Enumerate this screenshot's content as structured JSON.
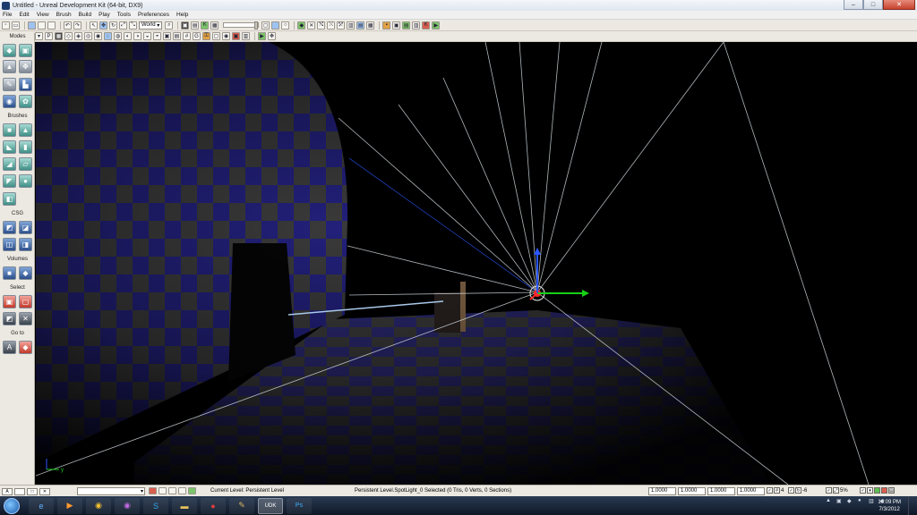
{
  "window": {
    "title": "Untitled - Unreal Development Kit (64-bit, DX9)",
    "minimize": "–",
    "maximize": "□",
    "close": "✕"
  },
  "menu": [
    "File",
    "Edit",
    "View",
    "Brush",
    "Build",
    "Play",
    "Tools",
    "Preferences",
    "Help"
  ],
  "toolbar": {
    "coord_system": "World"
  },
  "modes_panel": {
    "header": "Modes",
    "brushes_label": "Brushes",
    "csg_label": "CSG",
    "volumes_label": "Volumes",
    "select_label": "Select",
    "goto_label": "Go to"
  },
  "viewport": {
    "axis_label": "y"
  },
  "statusbar": {
    "current_level": "Current Level:  Persistent Level",
    "selection_status": "Persistent Level.SpotLight_0 Selected (0 Tris, 0 Verts, 0 Sections)",
    "drag_grid": [
      "1.0000",
      "1.0000",
      "1.0000",
      "1.0000"
    ],
    "grid_size": "4",
    "rotation_snap": "-6",
    "scale_snap": "5%"
  },
  "taskbar": {
    "time": "10:09 PM",
    "date": "7/3/2012"
  },
  "colors": {
    "wall_blue": "#22207a",
    "wall_gray": "#4a4a4a",
    "light_ray": "#cfd6dc",
    "arrow_green": "#17d117",
    "arrow_blue": "#2a56ff",
    "arrow_red": "#ff2a2a"
  }
}
